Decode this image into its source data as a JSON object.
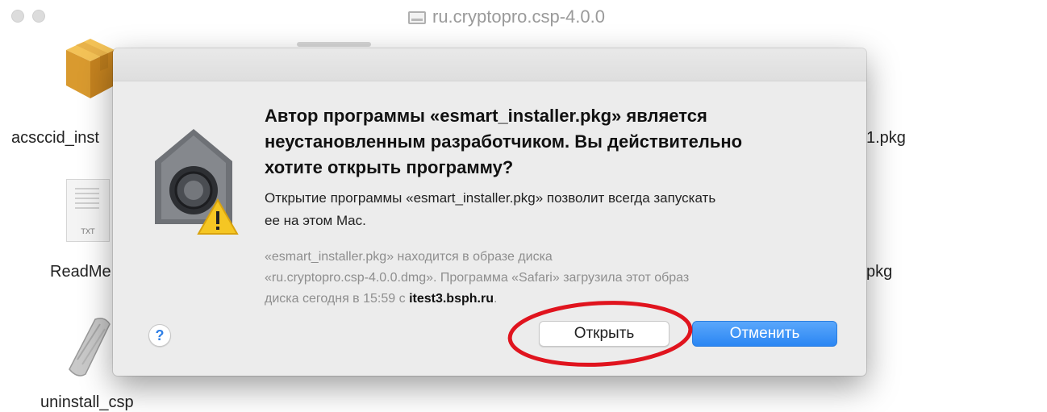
{
  "window": {
    "title": "ru.cryptopro.csp-4.0.0"
  },
  "files": {
    "left": [
      "acsccid_inst",
      "ReadMe",
      "uninstall_csp"
    ],
    "right": [
      "1.pkg",
      "pkg"
    ],
    "txt_ext": "TXT"
  },
  "dialog": {
    "title_line1": "Автор программы «esmart_installer.pkg» является",
    "title_line2": "неустановленным разработчиком. Вы действительно",
    "title_line3": "хотите открыть программу?",
    "message_line1": "Открытие программы «esmart_installer.pkg» позволит всегда запускать",
    "message_line2": "ее на этом Mac.",
    "info_line1": "«esmart_installer.pkg» находится в образе диска",
    "info_line2": "«ru.cryptopro.csp-4.0.0.dmg». Программа «Safari» загрузила этот образ",
    "info_line3_prefix": "диска сегодня в 15:59 с ",
    "info_host": "itest3.bsph.ru",
    "info_line3_suffix": ".",
    "help_label": "?",
    "open_button": "Открыть",
    "cancel_button": "Отменить"
  },
  "colors": {
    "accent": "#2b86f3",
    "annotation": "#e0141e"
  }
}
